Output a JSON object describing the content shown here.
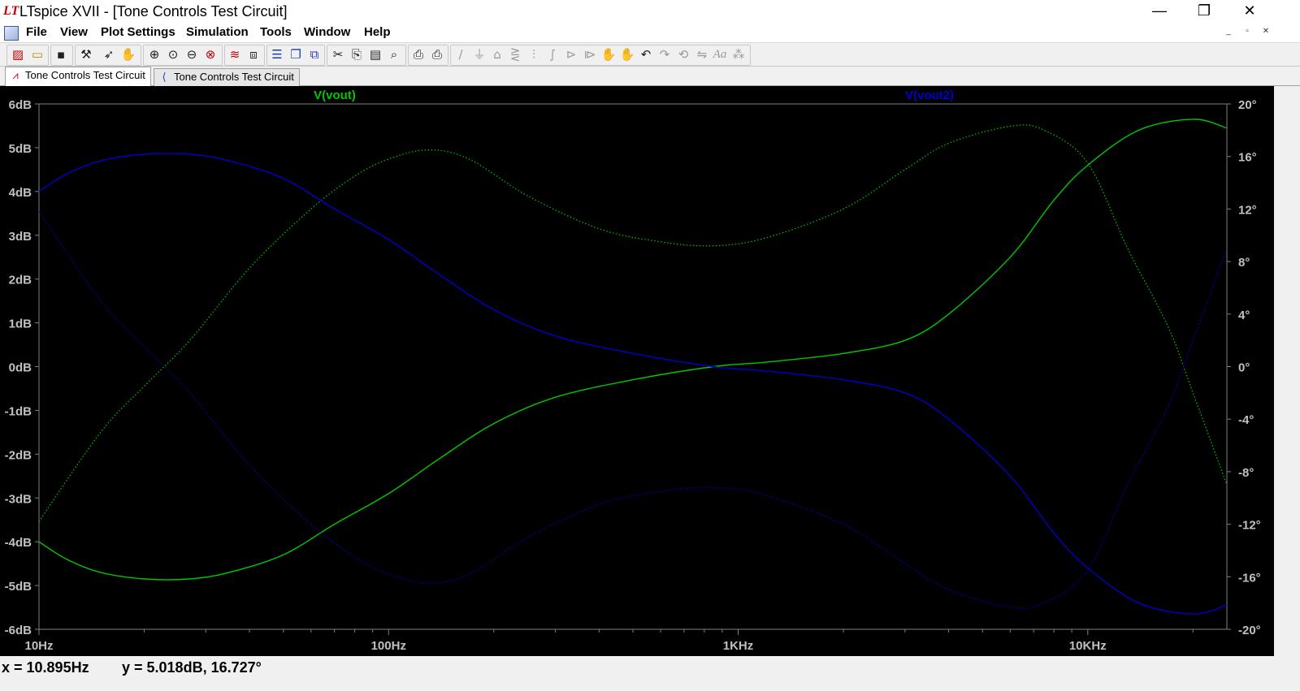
{
  "window": {
    "title": "LTspice XVII - [Tone Controls Test Circuit]",
    "logo": "LT",
    "minimize": "—",
    "maximize": "❐",
    "close": "✕"
  },
  "menu": {
    "items": [
      "File",
      "View",
      "Plot Settings",
      "Simulation",
      "Tools",
      "Window",
      "Help"
    ],
    "mdi_buttons": [
      "_",
      "▫",
      "✕"
    ]
  },
  "toolbar": {
    "icons": [
      "new-schematic-icon",
      "open-icon",
      "save-icon",
      "control-panel-icon",
      "run-icon",
      "halt-icon",
      "zoom-in-icon",
      "zoom-full-icon",
      "zoom-out-icon",
      "autorange-icon",
      "pick-traces-icon",
      "plot-settings-icon",
      "tile-horizontal-icon",
      "tile-vertical-icon",
      "cascade-icon",
      "cut-icon",
      "copy-icon",
      "paste-icon",
      "find-icon",
      "print-preview-icon",
      "print-icon",
      "wire-icon",
      "ground-icon",
      "label-net-icon",
      "resistor-icon",
      "capacitor-icon",
      "inductor-icon",
      "diode-icon",
      "component-icon",
      "move-icon",
      "drag-icon",
      "undo-icon",
      "redo-icon",
      "rotate-icon",
      "mirror-icon",
      "text-icon",
      "spice-directive-icon"
    ]
  },
  "tabs": [
    {
      "label": "Tone Controls Test Circuit",
      "icon": "waveform-icon",
      "active": true
    },
    {
      "label": "Tone Controls Test Circuit",
      "icon": "schematic-icon",
      "active": false
    }
  ],
  "colors": {
    "green": "#00c800",
    "blue": "#0000d0",
    "grid": "#2a2a2a",
    "axis": "#808080",
    "label": "#c0c0c0"
  },
  "chart_data": {
    "type": "line",
    "x_scale": "log",
    "xlim": [
      10,
      25000
    ],
    "ylim_left": [
      -6,
      6
    ],
    "ylim_right": [
      -20,
      20
    ],
    "x_ticks": [
      10,
      100,
      1000,
      10000
    ],
    "x_tick_labels": [
      "10Hz",
      "100Hz",
      "1KHz",
      "10KHz"
    ],
    "y_left_ticks": [
      "6dB",
      "5dB",
      "4dB",
      "3dB",
      "2dB",
      "1dB",
      "0dB",
      "-1dB",
      "-2dB",
      "-3dB",
      "-4dB",
      "-5dB",
      "-6dB"
    ],
    "y_right_ticks": [
      "20°",
      "16°",
      "12°",
      "8°",
      "4°",
      "0°",
      "-4°",
      "-8°",
      "-12°",
      "-16°",
      "-20°"
    ],
    "grid": false,
    "series": [
      {
        "name": "V(vout)",
        "color": "#00c800",
        "magnitude_db": [
          [
            10,
            -4.0
          ],
          [
            12,
            -4.4
          ],
          [
            15,
            -4.7
          ],
          [
            20,
            -4.85
          ],
          [
            27,
            -4.85
          ],
          [
            35,
            -4.7
          ],
          [
            50,
            -4.3
          ],
          [
            70,
            -3.6
          ],
          [
            100,
            -2.9
          ],
          [
            140,
            -2.1
          ],
          [
            200,
            -1.3
          ],
          [
            300,
            -0.7
          ],
          [
            500,
            -0.3
          ],
          [
            850,
            0.0
          ],
          [
            1200,
            0.1
          ],
          [
            2000,
            0.3
          ],
          [
            3000,
            0.6
          ],
          [
            4000,
            1.2
          ],
          [
            6000,
            2.5
          ],
          [
            8000,
            3.8
          ],
          [
            10000,
            4.6
          ],
          [
            14000,
            5.4
          ],
          [
            20000,
            5.65
          ],
          [
            25000,
            5.45
          ]
        ],
        "phase_deg": [
          [
            10,
            -11.8
          ],
          [
            15,
            -5.0
          ],
          [
            20,
            -1.5
          ],
          [
            27,
            2.0
          ],
          [
            40,
            7.5
          ],
          [
            60,
            12.0
          ],
          [
            80,
            14.5
          ],
          [
            100,
            15.8
          ],
          [
            130,
            16.5
          ],
          [
            170,
            15.8
          ],
          [
            250,
            13.0
          ],
          [
            400,
            10.5
          ],
          [
            600,
            9.5
          ],
          [
            850,
            9.2
          ],
          [
            1200,
            9.8
          ],
          [
            2000,
            12.0
          ],
          [
            3000,
            15.0
          ],
          [
            4000,
            17.0
          ],
          [
            6000,
            18.3
          ],
          [
            7500,
            18.0
          ],
          [
            10000,
            15.5
          ],
          [
            13000,
            9.0
          ],
          [
            17000,
            3.0
          ],
          [
            20000,
            -2.0
          ],
          [
            25000,
            -9.0
          ]
        ]
      },
      {
        "name": "V(vout2)",
        "color": "#0000d0",
        "magnitude_db": [
          [
            10,
            4.0
          ],
          [
            12,
            4.4
          ],
          [
            15,
            4.7
          ],
          [
            20,
            4.85
          ],
          [
            27,
            4.85
          ],
          [
            35,
            4.7
          ],
          [
            50,
            4.3
          ],
          [
            70,
            3.6
          ],
          [
            100,
            2.9
          ],
          [
            140,
            2.1
          ],
          [
            200,
            1.3
          ],
          [
            300,
            0.7
          ],
          [
            500,
            0.3
          ],
          [
            850,
            0.0
          ],
          [
            1200,
            -0.1
          ],
          [
            2000,
            -0.3
          ],
          [
            3000,
            -0.6
          ],
          [
            4000,
            -1.2
          ],
          [
            6000,
            -2.5
          ],
          [
            8000,
            -3.8
          ],
          [
            10000,
            -4.6
          ],
          [
            14000,
            -5.4
          ],
          [
            20000,
            -5.65
          ],
          [
            25000,
            -5.45
          ]
        ],
        "phase_deg": [
          [
            10,
            11.8
          ],
          [
            15,
            5.0
          ],
          [
            20,
            1.5
          ],
          [
            27,
            -2.0
          ],
          [
            40,
            -7.5
          ],
          [
            60,
            -12.0
          ],
          [
            80,
            -14.5
          ],
          [
            100,
            -15.8
          ],
          [
            130,
            -16.5
          ],
          [
            170,
            -15.8
          ],
          [
            250,
            -13.0
          ],
          [
            400,
            -10.5
          ],
          [
            600,
            -9.5
          ],
          [
            850,
            -9.2
          ],
          [
            1200,
            -9.8
          ],
          [
            2000,
            -12.0
          ],
          [
            3000,
            -15.0
          ],
          [
            4000,
            -17.0
          ],
          [
            6000,
            -18.3
          ],
          [
            7500,
            -18.0
          ],
          [
            10000,
            -15.5
          ],
          [
            13000,
            -9.0
          ],
          [
            17000,
            -3.0
          ],
          [
            20000,
            2.0
          ],
          [
            25000,
            9.0
          ]
        ]
      }
    ]
  },
  "status": {
    "x": "x = 10.895Hz",
    "y": "y = 5.018dB, 16.727°"
  }
}
